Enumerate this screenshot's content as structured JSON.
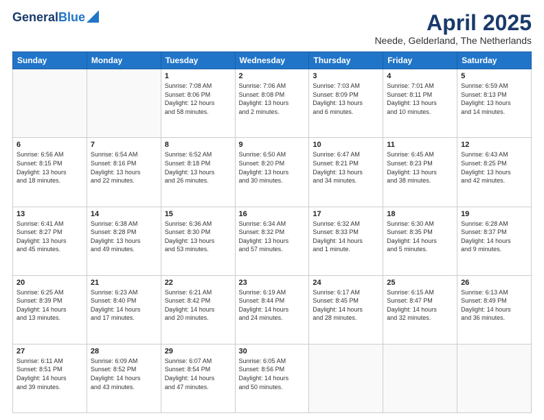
{
  "header": {
    "logo_line1": "General",
    "logo_line2": "Blue",
    "month": "April 2025",
    "location": "Neede, Gelderland, The Netherlands"
  },
  "weekdays": [
    "Sunday",
    "Monday",
    "Tuesday",
    "Wednesday",
    "Thursday",
    "Friday",
    "Saturday"
  ],
  "weeks": [
    [
      {
        "day": "",
        "info": ""
      },
      {
        "day": "",
        "info": ""
      },
      {
        "day": "1",
        "info": "Sunrise: 7:08 AM\nSunset: 8:06 PM\nDaylight: 12 hours\nand 58 minutes."
      },
      {
        "day": "2",
        "info": "Sunrise: 7:06 AM\nSunset: 8:08 PM\nDaylight: 13 hours\nand 2 minutes."
      },
      {
        "day": "3",
        "info": "Sunrise: 7:03 AM\nSunset: 8:09 PM\nDaylight: 13 hours\nand 6 minutes."
      },
      {
        "day": "4",
        "info": "Sunrise: 7:01 AM\nSunset: 8:11 PM\nDaylight: 13 hours\nand 10 minutes."
      },
      {
        "day": "5",
        "info": "Sunrise: 6:59 AM\nSunset: 8:13 PM\nDaylight: 13 hours\nand 14 minutes."
      }
    ],
    [
      {
        "day": "6",
        "info": "Sunrise: 6:56 AM\nSunset: 8:15 PM\nDaylight: 13 hours\nand 18 minutes."
      },
      {
        "day": "7",
        "info": "Sunrise: 6:54 AM\nSunset: 8:16 PM\nDaylight: 13 hours\nand 22 minutes."
      },
      {
        "day": "8",
        "info": "Sunrise: 6:52 AM\nSunset: 8:18 PM\nDaylight: 13 hours\nand 26 minutes."
      },
      {
        "day": "9",
        "info": "Sunrise: 6:50 AM\nSunset: 8:20 PM\nDaylight: 13 hours\nand 30 minutes."
      },
      {
        "day": "10",
        "info": "Sunrise: 6:47 AM\nSunset: 8:21 PM\nDaylight: 13 hours\nand 34 minutes."
      },
      {
        "day": "11",
        "info": "Sunrise: 6:45 AM\nSunset: 8:23 PM\nDaylight: 13 hours\nand 38 minutes."
      },
      {
        "day": "12",
        "info": "Sunrise: 6:43 AM\nSunset: 8:25 PM\nDaylight: 13 hours\nand 42 minutes."
      }
    ],
    [
      {
        "day": "13",
        "info": "Sunrise: 6:41 AM\nSunset: 8:27 PM\nDaylight: 13 hours\nand 45 minutes."
      },
      {
        "day": "14",
        "info": "Sunrise: 6:38 AM\nSunset: 8:28 PM\nDaylight: 13 hours\nand 49 minutes."
      },
      {
        "day": "15",
        "info": "Sunrise: 6:36 AM\nSunset: 8:30 PM\nDaylight: 13 hours\nand 53 minutes."
      },
      {
        "day": "16",
        "info": "Sunrise: 6:34 AM\nSunset: 8:32 PM\nDaylight: 13 hours\nand 57 minutes."
      },
      {
        "day": "17",
        "info": "Sunrise: 6:32 AM\nSunset: 8:33 PM\nDaylight: 14 hours\nand 1 minute."
      },
      {
        "day": "18",
        "info": "Sunrise: 6:30 AM\nSunset: 8:35 PM\nDaylight: 14 hours\nand 5 minutes."
      },
      {
        "day": "19",
        "info": "Sunrise: 6:28 AM\nSunset: 8:37 PM\nDaylight: 14 hours\nand 9 minutes."
      }
    ],
    [
      {
        "day": "20",
        "info": "Sunrise: 6:25 AM\nSunset: 8:39 PM\nDaylight: 14 hours\nand 13 minutes."
      },
      {
        "day": "21",
        "info": "Sunrise: 6:23 AM\nSunset: 8:40 PM\nDaylight: 14 hours\nand 17 minutes."
      },
      {
        "day": "22",
        "info": "Sunrise: 6:21 AM\nSunset: 8:42 PM\nDaylight: 14 hours\nand 20 minutes."
      },
      {
        "day": "23",
        "info": "Sunrise: 6:19 AM\nSunset: 8:44 PM\nDaylight: 14 hours\nand 24 minutes."
      },
      {
        "day": "24",
        "info": "Sunrise: 6:17 AM\nSunset: 8:45 PM\nDaylight: 14 hours\nand 28 minutes."
      },
      {
        "day": "25",
        "info": "Sunrise: 6:15 AM\nSunset: 8:47 PM\nDaylight: 14 hours\nand 32 minutes."
      },
      {
        "day": "26",
        "info": "Sunrise: 6:13 AM\nSunset: 8:49 PM\nDaylight: 14 hours\nand 36 minutes."
      }
    ],
    [
      {
        "day": "27",
        "info": "Sunrise: 6:11 AM\nSunset: 8:51 PM\nDaylight: 14 hours\nand 39 minutes."
      },
      {
        "day": "28",
        "info": "Sunrise: 6:09 AM\nSunset: 8:52 PM\nDaylight: 14 hours\nand 43 minutes."
      },
      {
        "day": "29",
        "info": "Sunrise: 6:07 AM\nSunset: 8:54 PM\nDaylight: 14 hours\nand 47 minutes."
      },
      {
        "day": "30",
        "info": "Sunrise: 6:05 AM\nSunset: 8:56 PM\nDaylight: 14 hours\nand 50 minutes."
      },
      {
        "day": "",
        "info": ""
      },
      {
        "day": "",
        "info": ""
      },
      {
        "day": "",
        "info": ""
      }
    ]
  ]
}
